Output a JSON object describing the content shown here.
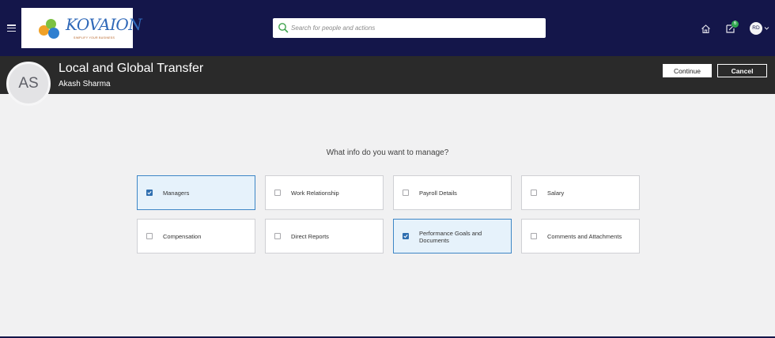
{
  "app": {
    "logo_text": "KOVAION",
    "logo_tagline": "SIMPLIFY YOUR BUSINESS"
  },
  "search": {
    "placeholder": "Search for people and actions"
  },
  "topbar": {
    "notifications_count": "6",
    "user_initials": "RD"
  },
  "header": {
    "title": "Local and Global Transfer",
    "person_name": "Akash Sharma",
    "person_initials": "AS",
    "continue_label": "Continue",
    "cancel_label": "Cancel"
  },
  "main": {
    "question": "What info do you want to manage?",
    "options": [
      {
        "label": "Managers",
        "checked": true
      },
      {
        "label": "Work Relationship",
        "checked": false
      },
      {
        "label": "Payroll Details",
        "checked": false
      },
      {
        "label": "Salary",
        "checked": false
      },
      {
        "label": "Compensation",
        "checked": false
      },
      {
        "label": "Direct Reports",
        "checked": false
      },
      {
        "label": "Performance Goals and Documents",
        "checked": true
      },
      {
        "label": "Comments and Attachments",
        "checked": false
      }
    ]
  },
  "colors": {
    "topbar": "#14164a",
    "header": "#2a2a2a",
    "selected_tile": "#e6f2fb",
    "accent": "#3d86c6"
  }
}
